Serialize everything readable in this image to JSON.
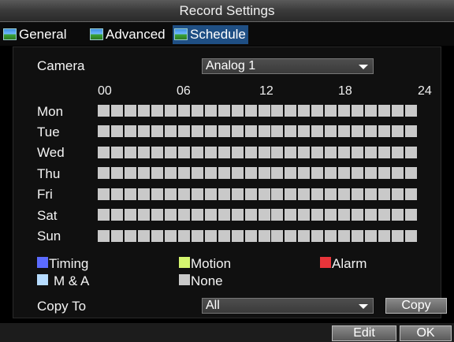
{
  "window": {
    "title": "Record Settings"
  },
  "tabs": [
    {
      "label": "General",
      "icon": "tab-image-icon",
      "active": false
    },
    {
      "label": "Advanced",
      "icon": "tab-image-icon",
      "active": false
    },
    {
      "label": "Schedule",
      "icon": "tab-image-icon",
      "active": true
    }
  ],
  "schedule": {
    "camera_label": "Camera",
    "camera_value": "Analog 1",
    "hour_labels": [
      "00",
      "06",
      "12",
      "18",
      "24"
    ],
    "days": [
      "Mon",
      "Tue",
      "Wed",
      "Thu",
      "Fri",
      "Sat",
      "Sun"
    ],
    "slots_per_day": 24,
    "slot_state": "None"
  },
  "legend": [
    {
      "label": "Timing",
      "color": "#5b6bff"
    },
    {
      "label": "Motion",
      "color": "#d4f56e"
    },
    {
      "label": "Alarm",
      "color": "#e8343a"
    },
    {
      "label": "M & A",
      "color": "#b6dcff"
    },
    {
      "label": "None",
      "color": "#c9c9c9"
    }
  ],
  "copy": {
    "label": "Copy To",
    "value": "All",
    "button": "Copy"
  },
  "footer": {
    "edit": "Edit",
    "ok": "OK"
  }
}
